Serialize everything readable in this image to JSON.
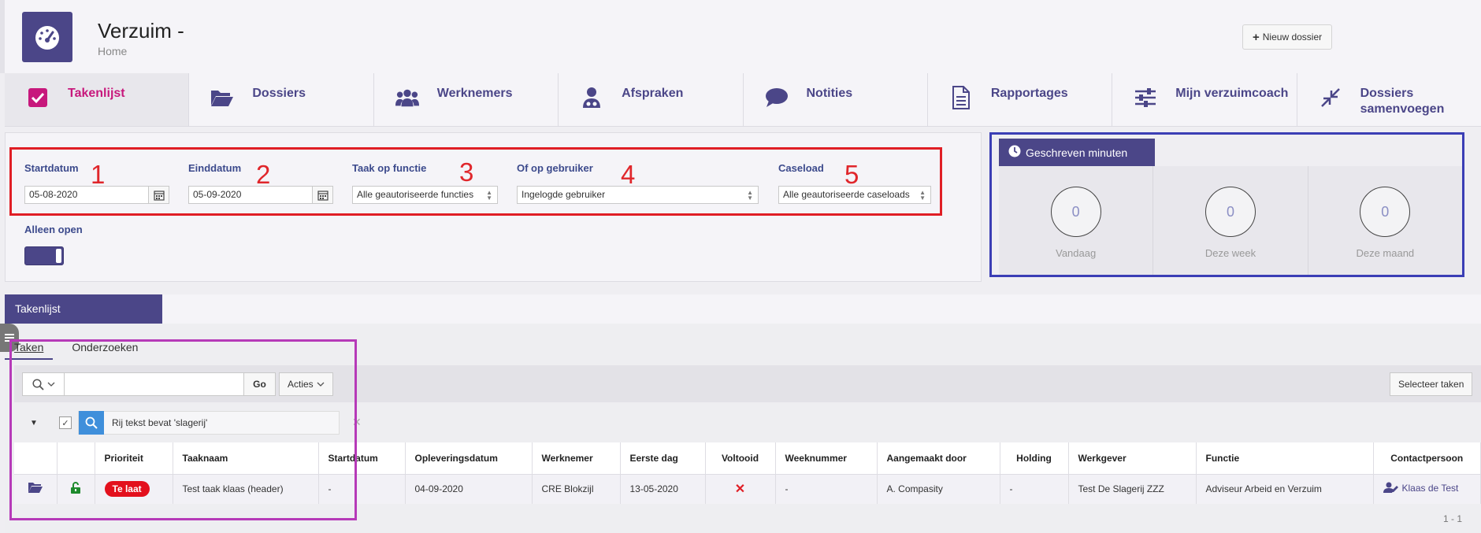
{
  "header": {
    "title": "Verzuim -",
    "subtitle": "Home",
    "new_dossier_label": "Nieuw dossier"
  },
  "nav": [
    {
      "label": "Takenlijst",
      "icon": "checkbox-icon",
      "active": true
    },
    {
      "label": "Dossiers",
      "icon": "folder-open-icon"
    },
    {
      "label": "Werknemers",
      "icon": "users-icon"
    },
    {
      "label": "Afspraken",
      "icon": "user-doctor-icon"
    },
    {
      "label": "Notities",
      "icon": "comment-icon"
    },
    {
      "label": "Rapportages",
      "icon": "document-icon"
    },
    {
      "label": "Mijn verzuimcoach",
      "icon": "sliders-icon"
    },
    {
      "label": "Dossiers\nsamenvoegen",
      "icon": "compress-icon"
    }
  ],
  "filters": {
    "startdatum_label": "Startdatum",
    "startdatum_value": "05-08-2020",
    "einddatum_label": "Einddatum",
    "einddatum_value": "05-09-2020",
    "taak_op_functie_label": "Taak op functie",
    "taak_op_functie_value": "Alle geautoriseerde functies",
    "of_op_gebruiker_label": "Of op gebruiker",
    "of_op_gebruiker_value": "Ingelogde gebruiker",
    "caseload_label": "Caseload",
    "caseload_value": "Alle geautoriseerde caseloads",
    "alleen_open_label": "Alleen open",
    "alleen_open_on": true
  },
  "annotations": [
    "1",
    "2",
    "3",
    "4",
    "5"
  ],
  "minutes": {
    "tab_label": "Geschreven minuten",
    "items": [
      {
        "value": "0",
        "label": "Vandaag"
      },
      {
        "value": "0",
        "label": "Deze week"
      },
      {
        "value": "0",
        "label": "Deze maand"
      }
    ]
  },
  "takenlijst": {
    "tab_label": "Takenlijst",
    "subtabs": [
      "Taken",
      "Onderzoeken"
    ],
    "search_placeholder": "",
    "go_label": "Go",
    "acties_label": "Acties",
    "selecteer_label": "Selecteer taken",
    "filter_text": "Rij tekst bevat 'slagerij'",
    "filter_remove": "✕",
    "columns": [
      "",
      "",
      "Prioriteit",
      "Taaknaam",
      "Startdatum",
      "Opleveringsdatum",
      "Werknemer",
      "Eerste dag",
      "Voltooid",
      "Weeknummer",
      "Aangemaakt door",
      "Holding",
      "Werkgever",
      "Functie",
      "Contactpersoon"
    ],
    "rows": [
      {
        "prioriteit": "Te laat",
        "taaknaam": "Test taak klaas (header)",
        "startdatum": "-",
        "opleveringsdatum": "04-09-2020",
        "werknemer": "CRE Blokzijl",
        "eerste_dag": "13-05-2020",
        "voltooid": "✕",
        "weeknummer": "-",
        "aangemaakt_door": "A. Compasity",
        "holding": "-",
        "werkgever": "Test De Slagerij ZZZ",
        "functie": "Adviseur Arbeid en Verzuim",
        "contactpersoon": "Klaas de Test"
      }
    ],
    "pager": "1 - 1"
  },
  "colors": {
    "brand": "#4b4688",
    "active_nav": "#c7187c",
    "late_badge": "#e3101d",
    "annot_red": "#e01e25",
    "annot_blue": "#3b3eb5",
    "annot_purple": "#b63ab8"
  }
}
